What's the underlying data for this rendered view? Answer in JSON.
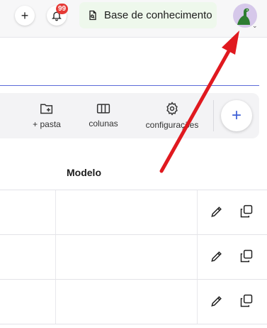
{
  "topbar": {
    "notification_count": "99",
    "knowledge_base_label": "Base de conhecimento"
  },
  "toolbar": {
    "new_folder_label": "+ pasta",
    "columns_label": "colunas",
    "settings_label": "configurações"
  },
  "table": {
    "column_header": "Modelo",
    "rows": [
      {},
      {},
      {}
    ]
  },
  "icons": {
    "add": "plus-icon",
    "notifications": "bell-icon",
    "knowledge_base": "document-search-icon",
    "avatar": "dinosaur-avatar",
    "new_folder": "folder-plus-icon",
    "columns": "columns-icon",
    "settings": "gear-icon",
    "edit": "pencil-icon",
    "duplicate": "copy-icon"
  },
  "colors": {
    "accent": "#3c5ed6",
    "badge": "#e53935",
    "annotation_arrow": "#e0191f"
  }
}
